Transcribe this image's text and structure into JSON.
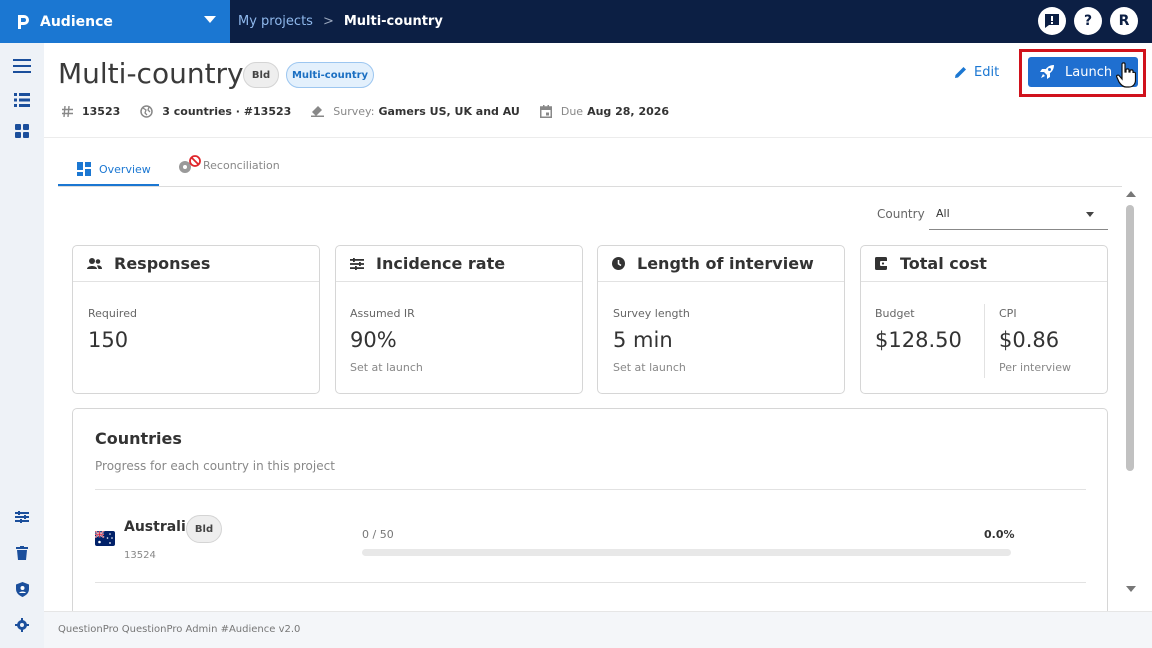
{
  "app": {
    "name": "Audience"
  },
  "breadcrumb": {
    "parent": "My projects",
    "separator": ">",
    "current": "Multi-country"
  },
  "topbar": {
    "avatar_initial": "R",
    "help_label": "?",
    "feedback_label": "!"
  },
  "project": {
    "title": "Multi-country",
    "chips": [
      "Bld",
      "Multi-country"
    ],
    "edit_label": "Edit",
    "launch_label": "Launch",
    "meta": {
      "id": "13523",
      "countries": "3 countries · #13523",
      "survey_label": "Survey:",
      "survey_value": "Gamers US, UK and AU",
      "due_label": "Due",
      "due_value": "Aug 28, 2026"
    }
  },
  "tabs": [
    {
      "label": "Overview",
      "active": true
    },
    {
      "label": "Reconciliation",
      "active": false
    }
  ],
  "filter": {
    "label": "Country",
    "value": "All"
  },
  "cards": {
    "responses": {
      "title": "Responses",
      "label": "Required",
      "value": "150"
    },
    "incidence": {
      "title": "Incidence rate",
      "label": "Assumed IR",
      "value": "90%",
      "sub": "Set at launch"
    },
    "loi": {
      "title": "Length of interview",
      "label": "Survey length",
      "value": "5 min",
      "sub": "Set at launch"
    },
    "cost": {
      "title": "Total cost",
      "budget_label": "Budget",
      "budget_value": "$128.50",
      "cpi_label": "CPI",
      "cpi_value": "$0.86",
      "cpi_sub": "Per interview"
    }
  },
  "countries": {
    "title": "Countries",
    "subtitle": "Progress for each country in this project",
    "items": [
      {
        "name": "Australia",
        "id": "13524",
        "chip": "Bld",
        "count": "0 / 50",
        "percent": "0.0%",
        "progress": 0.0
      }
    ]
  },
  "footer": {
    "text": "QuestionPro QuestionPro Admin   #Audience v2.0"
  },
  "colors": {
    "brand": "#1b77d2",
    "topbar": "#0c1f44",
    "launch": "#1f6fd0",
    "highlight": "#d0121c"
  }
}
